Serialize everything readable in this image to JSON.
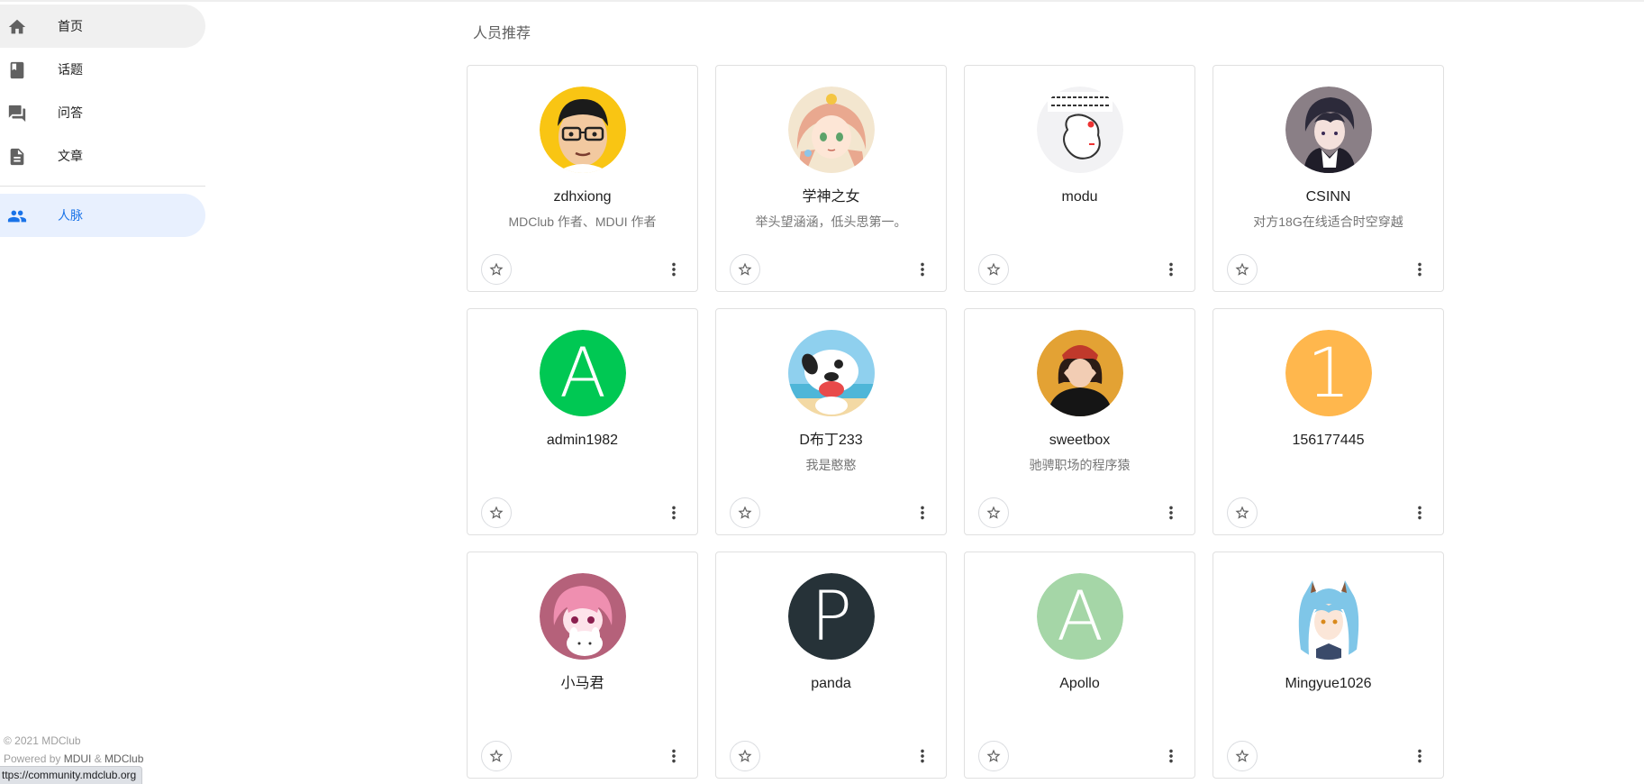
{
  "sidebar": {
    "items": [
      {
        "label": "首页",
        "icon": "home-icon"
      },
      {
        "label": "话题",
        "icon": "book-icon"
      },
      {
        "label": "问答",
        "icon": "forum-icon"
      },
      {
        "label": "文章",
        "icon": "description-icon"
      },
      {
        "label": "人脉",
        "icon": "people-icon",
        "active": true
      }
    ]
  },
  "main": {
    "title": "人员推荐"
  },
  "users": [
    {
      "name": "zdhxiong",
      "headline": "MDClub 作者、MDUI 作者"
    },
    {
      "name": "学神之女",
      "headline": "举头望涵涵，低头思第一。"
    },
    {
      "name": "modu",
      "headline": ""
    },
    {
      "name": "CSINN",
      "headline": "对方18G在线适合时空穿越"
    },
    {
      "name": "admin1982",
      "headline": "",
      "letter": "A",
      "color": "#00c853"
    },
    {
      "name": "D布丁233",
      "headline": "我是憨憨"
    },
    {
      "name": "sweetbox",
      "headline": "驰骋职场的程序猿"
    },
    {
      "name": "156177445",
      "headline": "",
      "letter": "1",
      "color": "#ffb74d"
    },
    {
      "name": "小马君",
      "headline": ""
    },
    {
      "name": "panda",
      "headline": "",
      "letter": "P",
      "color": "#263238"
    },
    {
      "name": "Apollo",
      "headline": "",
      "letter": "A",
      "color": "#a5d6a7"
    },
    {
      "name": "Mingyue1026",
      "headline": ""
    }
  ],
  "footer": {
    "copyright": "© 2021 MDClub",
    "powered_prefix": "Powered by ",
    "powered_mdui": "MDUI",
    "powered_amp": " & ",
    "powered_mdclub": "MDClub"
  },
  "status_url": "ttps://community.mdclub.org",
  "colors": {
    "accent": "#1a73e8",
    "active_bg": "#e8f0fe",
    "hover_bg": "#f0f0f0"
  }
}
